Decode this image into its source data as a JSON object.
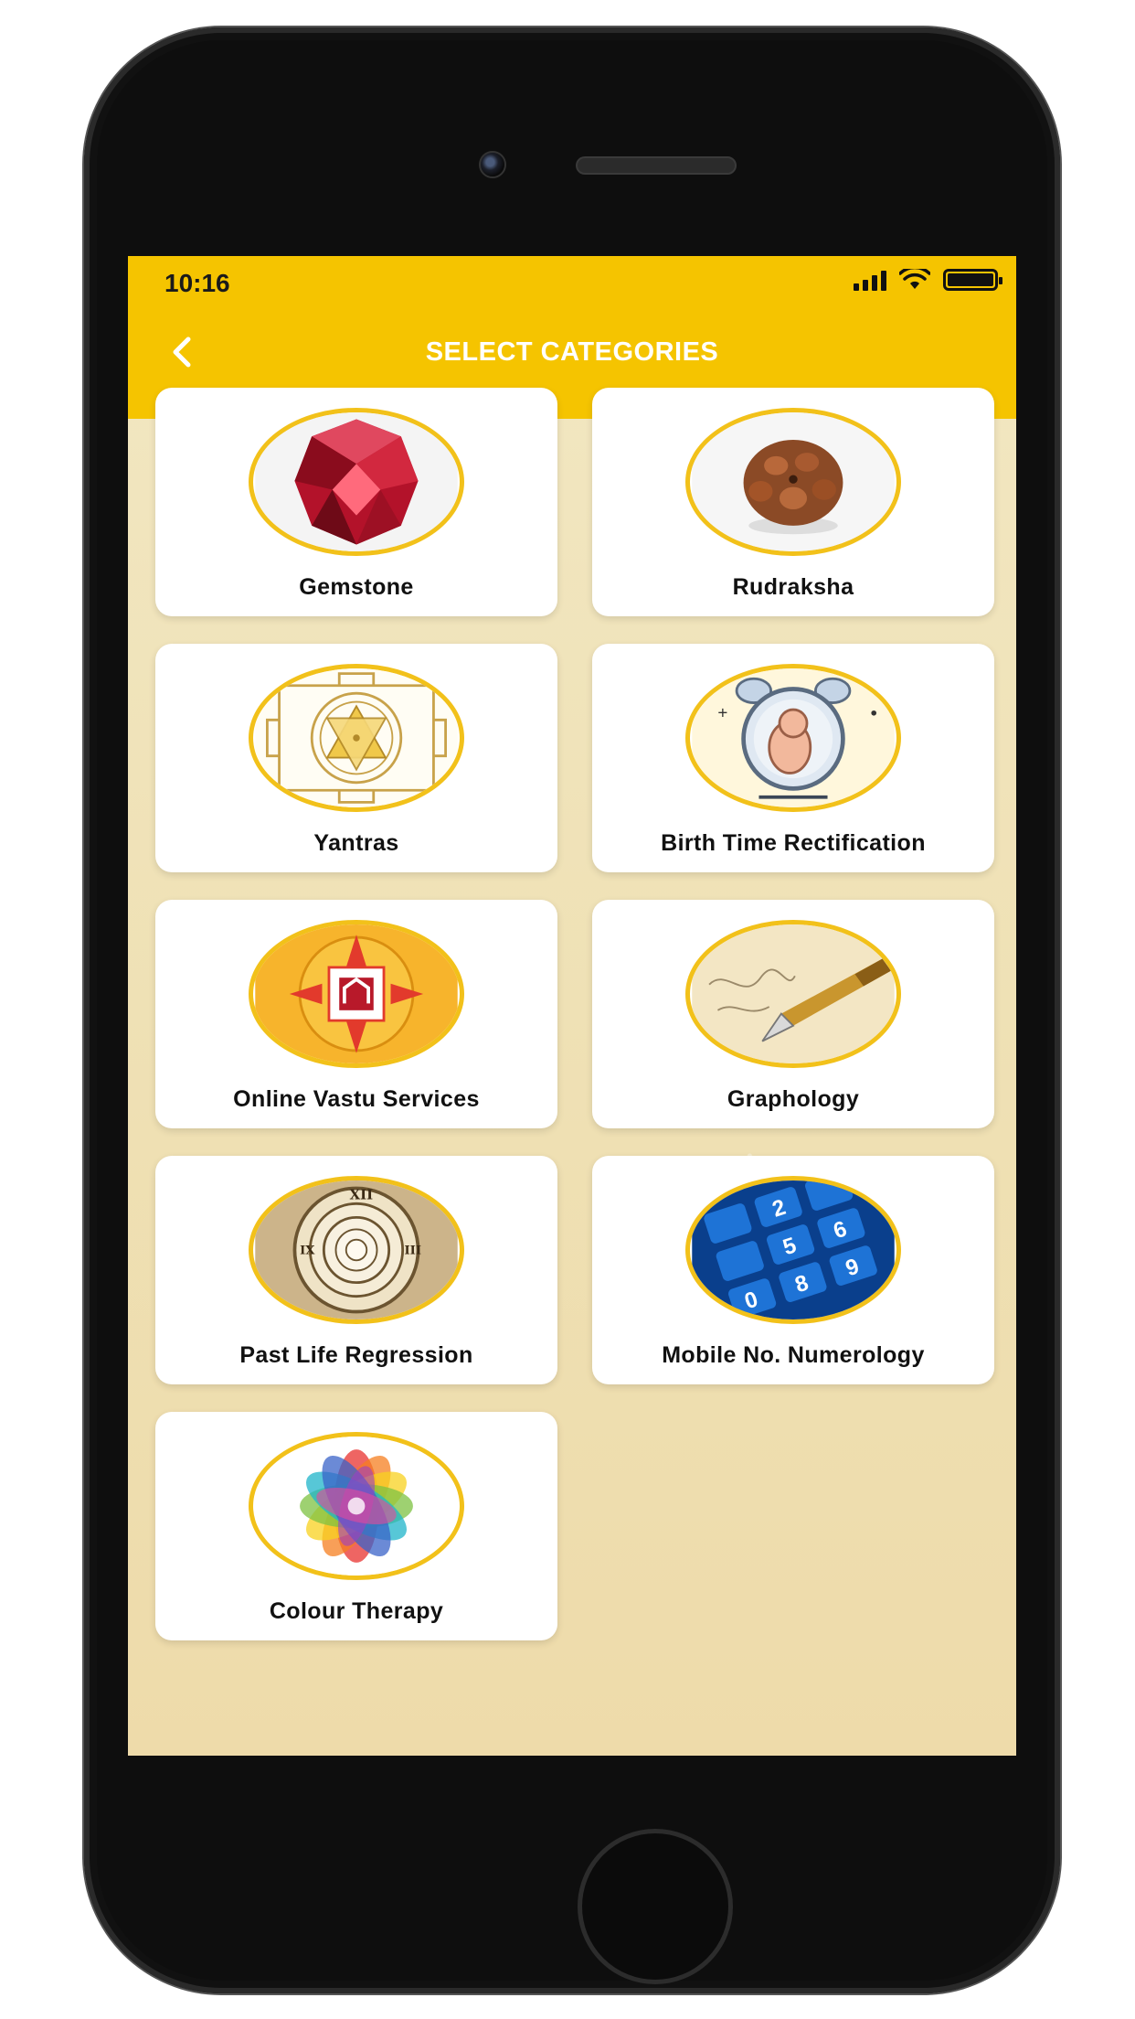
{
  "status_bar": {
    "time": "10:16"
  },
  "header": {
    "title": "SELECT CATEGORIES"
  },
  "categories": [
    {
      "label": "Gemstone",
      "icon": "gemstone-icon"
    },
    {
      "label": "Rudraksha",
      "icon": "rudraksha-icon"
    },
    {
      "label": "Yantras",
      "icon": "yantra-icon"
    },
    {
      "label": "Birth Time Rectification",
      "icon": "baby-clock-icon"
    },
    {
      "label": "Online Vastu Services",
      "icon": "vastu-compass-icon"
    },
    {
      "label": "Graphology",
      "icon": "fountain-pen-icon"
    },
    {
      "label": "Past Life Regression",
      "icon": "spiral-clock-icon"
    },
    {
      "label": "Mobile No. Numerology",
      "icon": "keypad-icon"
    },
    {
      "label": "Colour Therapy",
      "icon": "color-wheel-icon"
    }
  ],
  "colors": {
    "accent": "#f5c400",
    "icon_ring": "#f2c11a",
    "background": "#efe1b5"
  }
}
